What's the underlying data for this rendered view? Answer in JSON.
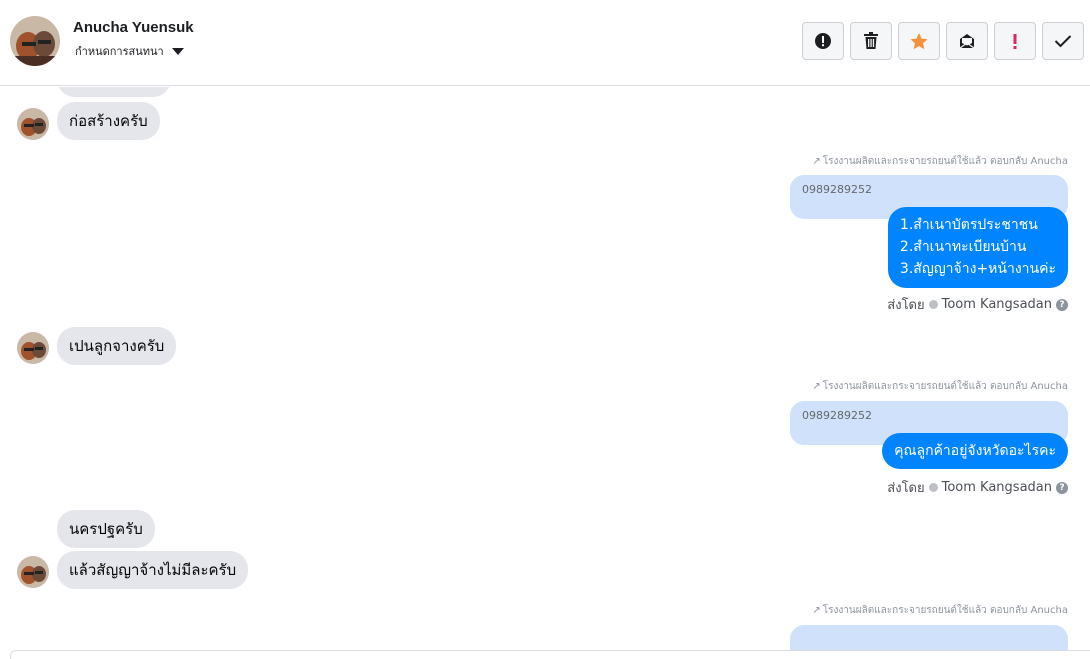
{
  "header": {
    "name": "Anucha Yuensuk",
    "assign_label": "กำหนดการสนทนา"
  },
  "toolbar": {
    "buttons": [
      {
        "name": "spam",
        "icon": "alert-circle-icon"
      },
      {
        "name": "delete",
        "icon": "trash-icon"
      },
      {
        "name": "star",
        "icon": "star-icon",
        "color": "#f7923a"
      },
      {
        "name": "mark-unread",
        "icon": "envelope-icon"
      },
      {
        "name": "important",
        "icon": "exclamation-icon",
        "color": "#e0245e"
      },
      {
        "name": "done",
        "icon": "check-icon"
      }
    ]
  },
  "messages": {
    "in1": "ก่อสร้างครับ",
    "reply_meta": "โรงงานผลิตและกระจายรถยนต์ใช้แล้ว ตอบกลับ Anucha",
    "quoted_phone": "0989289252",
    "out1_lines": [
      "1.สำเนาบัตรประชาชน",
      "2.สำเนาทะเบียนบ้าน",
      "3.สัญญาจ้าง+หน้างานค่ะ"
    ],
    "sent_by_label": "ส่งโดย",
    "agent_name": "Toom Kangsadan",
    "in2": "เปนลูกจางครับ",
    "out2": "คุณลูกค้าอยู่จังหวัดอะไรคะ",
    "in3": "นครปฐครับ",
    "in4": "แล้วสัญญาจ้างไม่มีละครับ"
  },
  "colors": {
    "outgoing_bubble": "#0084ff",
    "incoming_bubble": "#e4e6eb",
    "quoted_bubble": "#cfe1fb"
  }
}
